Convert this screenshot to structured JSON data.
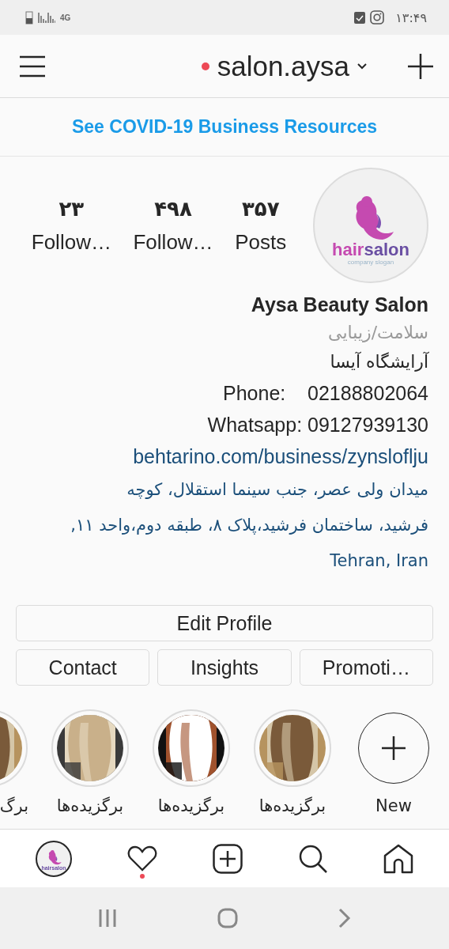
{
  "status_bar": {
    "network": "4G",
    "time": "۱۳:۴۹"
  },
  "header": {
    "username": "salon.aysa",
    "live_dot": true
  },
  "banner": {
    "link": "See COVID-19 Business Resources"
  },
  "profile": {
    "logo": {
      "word_1": "hair",
      "word_2": "salon",
      "slogan": "company slogan"
    },
    "stats": [
      {
        "value": "۳۵۷",
        "label": "Posts"
      },
      {
        "value": "۴۹۸",
        "label": "Follow…"
      },
      {
        "value": "۲۳",
        "label": "Follow…"
      }
    ]
  },
  "bio": {
    "name": "Aysa Beauty Salon",
    "category": "سلامت/زیبایی",
    "lines": [
      {
        "kind": "text",
        "text": "آرایشگاه آیسا"
      },
      {
        "kind": "contact",
        "label": "Phone:",
        "value": "02188802064"
      },
      {
        "kind": "contact",
        "label": "Whatsapp:",
        "value": "09127939130"
      },
      {
        "kind": "link",
        "text": "behtarino.com/business/zynsloflju"
      },
      {
        "kind": "address",
        "lines": [
          "میدان ولی عصر، جنب سینما استقلال، کوچه",
          "فرشید، ساختمان فرشید،پلاک ۸، طبقه دوم،واحد ۱۱,",
          "Tehran, Iran"
        ]
      }
    ]
  },
  "buttons": {
    "main": "Edit Profile",
    "row": [
      "Promoti…",
      "Insights",
      "Contact"
    ]
  },
  "highlights": [
    {
      "kind": "new",
      "label": "New"
    },
    {
      "kind": "picture",
      "label": "برگزیده‌ها"
    },
    {
      "kind": "picture",
      "label": "برگزیده‌ها"
    },
    {
      "kind": "picture",
      "label": "برگزیده‌ها"
    },
    {
      "kind": "picture",
      "label": "برگ"
    }
  ],
  "bottom_nav": {
    "avatar_text": "hairsalon",
    "activity_dot": true
  }
}
